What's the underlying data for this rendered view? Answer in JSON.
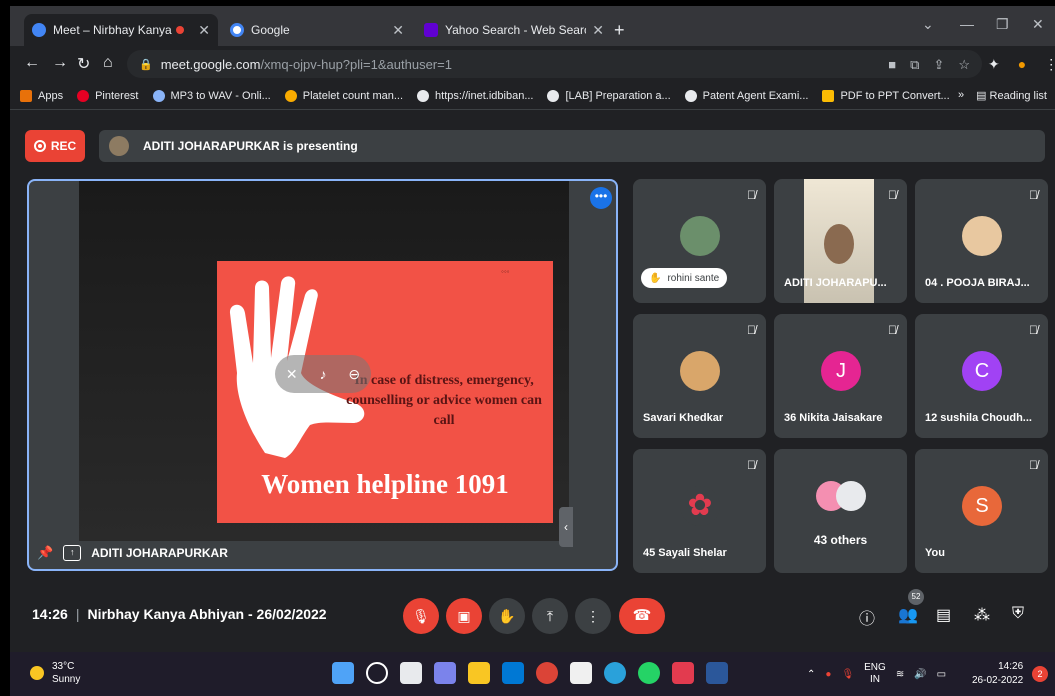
{
  "browser": {
    "tabs": [
      {
        "title": "Meet – Nirbhay Kanya Abhiy",
        "favicon": "meet-icon"
      },
      {
        "title": "Google",
        "favicon": "google-icon"
      },
      {
        "title": "Yahoo Search - Web Search",
        "favicon": "yahoo-icon"
      }
    ],
    "url_host": "meet.google.com",
    "url_path": "/xmq-ojpv-hup?pli=1&authuser=1",
    "bookmarks": [
      {
        "label": "Apps"
      },
      {
        "label": "Pinterest"
      },
      {
        "label": "MP3 to WAV - Onli..."
      },
      {
        "label": "Platelet count man..."
      },
      {
        "label": "https://inet.idbiban..."
      },
      {
        "label": "[LAB] Preparation a..."
      },
      {
        "label": "Patent Agent Exami..."
      },
      {
        "label": "PDF to PPT Convert..."
      }
    ],
    "reading_list": "Reading list"
  },
  "meet": {
    "rec_label": "REC",
    "presenting_text": "ADITI JOHARAPURKAR is presenting",
    "presenter_name": "ADITI JOHARAPURKAR",
    "slide": {
      "body": "In case of distress, emergency, counselling or advice women can call",
      "title": "Women helpline 1091"
    },
    "participants": [
      {
        "name": "rohini sante",
        "avatar_color": "#5f6368"
      },
      {
        "name": "ADITI JOHARAPU...",
        "avatar_color": "#8a6a50"
      },
      {
        "name": "04 . POOJA BIRAJ...",
        "avatar_color": "#e8c8a0"
      },
      {
        "name": "Savari Khedkar",
        "avatar_color": "#d9a66a"
      },
      {
        "name": "36 Nikita Jaisakare",
        "initial": "J",
        "avatar_color": "#e52592"
      },
      {
        "name": "12 sushila Choudh...",
        "initial": "C",
        "avatar_color": "#a142f4"
      },
      {
        "name": "45 Sayali Shelar",
        "avatar_color": "#e23b4f"
      },
      {
        "name": "43 others"
      },
      {
        "name": "You",
        "initial": "S",
        "avatar_color": "#e8683a"
      }
    ],
    "time": "14:26",
    "meeting_title": "Nirbhay Kanya Abhiyan - 26/02/2022",
    "people_count": "52"
  },
  "taskbar": {
    "temperature": "33°C",
    "weather": "Sunny",
    "lang_top": "ENG",
    "lang_bottom": "IN",
    "clock_time": "14:26",
    "clock_date": "26-02-2022",
    "notifications": "2"
  }
}
